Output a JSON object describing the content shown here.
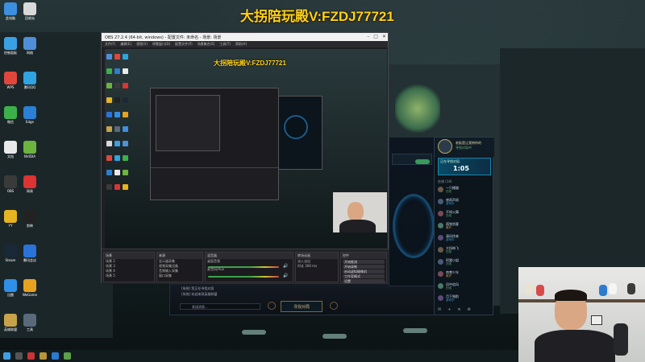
{
  "banner": {
    "title": "大拐陪玩殿V:FZDJ77721",
    "preview_title": "大拐陪玩殿V:FZDJ77721",
    "color": "#ffd21a"
  },
  "obs": {
    "window_title": "OBS 27.2.4 (64-bit, windows) - 配置文件: 未命名 - 场景: 场景",
    "menu": [
      "文件(F)",
      "编辑(E)",
      "视图(V)",
      "停靠窗口(D)",
      "配置文件(P)",
      "场景集合(S)",
      "工具(T)",
      "帮助(H)"
    ],
    "docks": {
      "scenes": {
        "header": "场景",
        "items": [
          "场景 2",
          "场景 3",
          "场景 4",
          "场景 5"
        ]
      },
      "sources": {
        "header": "来源",
        "items": [
          "显示器采集",
          "视频采集设备",
          "音频输入采集",
          "窗口采集"
        ]
      },
      "mixer": {
        "header": "混音器",
        "items": [
          "桌面音频",
          "麦克风/Aux"
        ]
      },
      "transitions": {
        "header": "转场动画",
        "items": [
          "淡入淡出",
          "时长 300 ms"
        ]
      },
      "controls": {
        "header": "控件",
        "items": [
          "开始推流",
          "开始录制",
          "启动虚拟摄像机",
          "工作室模式",
          "设置",
          "退出"
        ]
      }
    }
  },
  "client": {
    "chat_lines": [
      "[系统] 您正在寻找对局",
      "[系统] 欢迎来到英雄联盟",
      "发送消息..."
    ],
    "find_match": "寻找对局"
  },
  "lol": {
    "summoner": "老板是让我带你的",
    "status": "寻找对局中",
    "queue_label": "正在寻找对局",
    "queue_time": "1:05",
    "friends_header": "在线 (14)",
    "friends": [
      {
        "name": "一只橘猫",
        "status": "在线"
      },
      {
        "name": "夜雨声烦",
        "status": "游戏中"
      },
      {
        "name": "不知火舞",
        "status": "在线"
      },
      {
        "name": "孤独剑客",
        "status": "离开"
      },
      {
        "name": "清风徐来",
        "status": "游戏中"
      },
      {
        "name": "大拐带飞",
        "status": "在线"
      },
      {
        "name": "阿狸小姐",
        "status": "在线"
      },
      {
        "name": "南巷少年",
        "status": "离开"
      },
      {
        "name": "风中追风",
        "status": "在线"
      },
      {
        "name": "月下独酌",
        "status": "游戏中"
      }
    ]
  },
  "desktop_icons_left": [
    "此电脑",
    "回收站",
    "控制面板",
    "网络",
    "WPS",
    "腾讯QQ",
    "微信",
    "Edge",
    "文档",
    "NVIDIA",
    "OBS",
    "网易",
    "YY",
    "剪映",
    "Steam",
    "腾讯会议",
    "迅雷",
    "WeGame",
    "英雄联盟",
    "工具"
  ],
  "taskbar": {
    "time": ""
  }
}
